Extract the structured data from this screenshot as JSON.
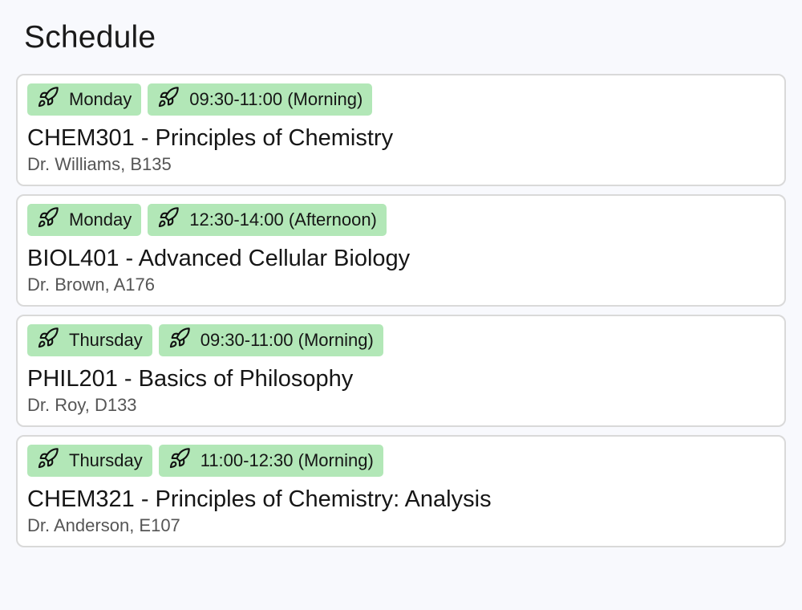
{
  "page": {
    "title": "Schedule"
  },
  "colors": {
    "background": "#f8f9fd",
    "card_border": "#d9d9d9",
    "tag_background": "#b2e7b7",
    "secondary_text": "#555555"
  },
  "tag_icon": "rocket-icon",
  "classes": [
    {
      "day": "Monday",
      "time": "09:30-11:00 (Morning)",
      "course": "CHEM301 - Principles of Chemistry",
      "details": "Dr. Williams, B135"
    },
    {
      "day": "Monday",
      "time": "12:30-14:00 (Afternoon)",
      "course": "BIOL401 - Advanced Cellular Biology",
      "details": "Dr. Brown, A176"
    },
    {
      "day": "Thursday",
      "time": "09:30-11:00 (Morning)",
      "course": "PHIL201 - Basics of Philosophy",
      "details": "Dr. Roy, D133"
    },
    {
      "day": "Thursday",
      "time": "11:00-12:30 (Morning)",
      "course": "CHEM321 - Principles of Chemistry: Analysis",
      "details": "Dr. Anderson, E107"
    }
  ]
}
